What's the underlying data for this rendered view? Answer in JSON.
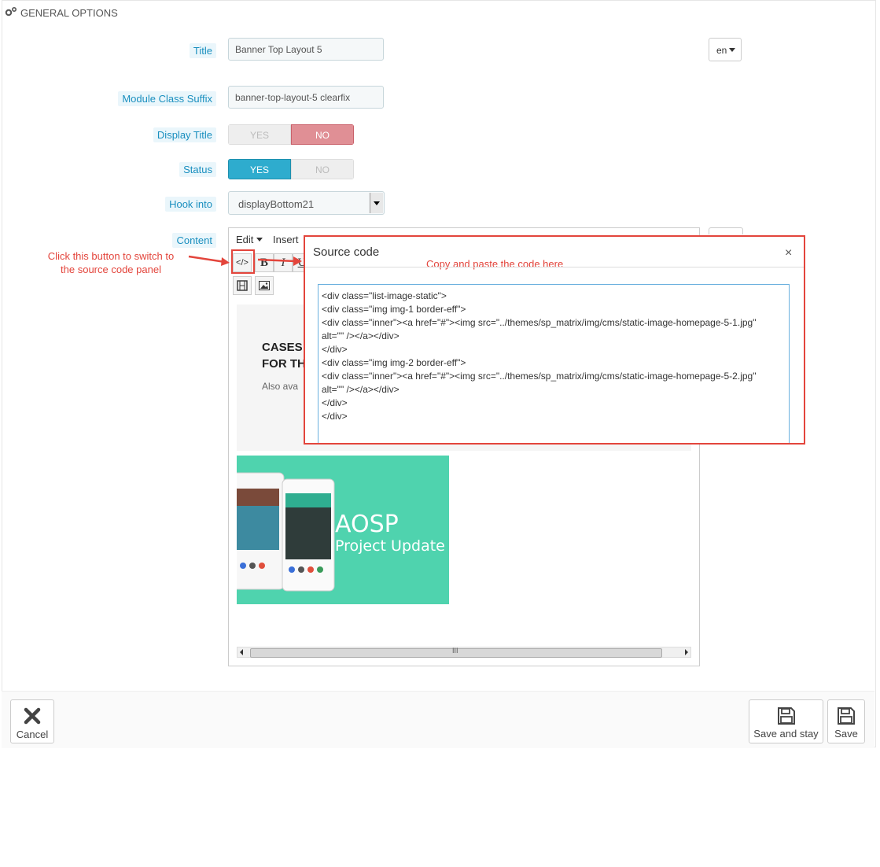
{
  "panel": {
    "heading": "GENERAL OPTIONS",
    "heading_icon": "cogs-icon"
  },
  "form": {
    "title": {
      "label": "Title",
      "value": "Banner Top Layout 5",
      "lang": "en"
    },
    "module_class_suffix": {
      "label": "Module Class Suffix",
      "value": "banner-top-layout-5 clearfix"
    },
    "display_title": {
      "label": "Display Title",
      "yes": "YES",
      "no": "NO",
      "selected": "NO"
    },
    "status": {
      "label": "Status",
      "yes": "YES",
      "no": "NO",
      "selected": "YES"
    },
    "hook_into": {
      "label": "Hook into",
      "value": "displayBottom21"
    },
    "content": {
      "label": "Content"
    }
  },
  "editor": {
    "menu": [
      "Edit",
      "Insert"
    ],
    "toolbar": {
      "source_code": "</>",
      "bold": "B",
      "italic": "I",
      "underline": "U"
    },
    "preview": {
      "heading_line1": "CASES",
      "heading_line2": "FOR TH",
      "subtext": "Also ava",
      "banner_title": "AOSP",
      "banner_subtitle": "Project Update"
    },
    "scroll_grip": "III"
  },
  "dialog": {
    "title": "Source code",
    "close": "×",
    "code": "<div class=\"list-image-static\">\n<div class=\"img img-1 border-eff\">\n<div class=\"inner\"><a href=\"#\"><img src=\"../themes/sp_matrix/img/cms/static-image-homepage-5-1.jpg\"\nalt=\"\" /></a></div>\n</div>\n<div class=\"img img-2 border-eff\">\n<div class=\"inner\"><a href=\"#\"><img src=\"../themes/sp_matrix/img/cms/static-image-homepage-5-2.jpg\"\nalt=\"\" /></a></div>\n</div>\n</div>"
  },
  "annotations": {
    "switch_hint_line1": "Click this button to switch to",
    "switch_hint_line2": "the source code panel",
    "paste_hint": "Copy and paste the code here",
    "color": "#e3453c"
  },
  "footer": {
    "cancel": "Cancel",
    "save_and_stay": "Save and stay",
    "save": "Save"
  }
}
